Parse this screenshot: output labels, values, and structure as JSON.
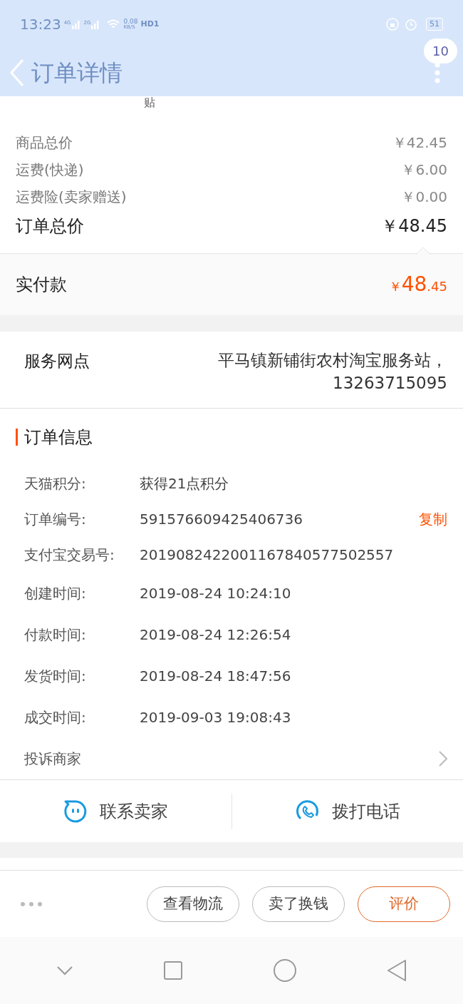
{
  "status_bar": {
    "time": "13:23",
    "signal_labels": [
      "4G",
      "2G"
    ],
    "speed": [
      "0.08",
      "KB/S"
    ],
    "hd": "HD1",
    "battery": "51"
  },
  "header": {
    "title": "订单详情",
    "badge": "10"
  },
  "cut_text": "贴",
  "prices": [
    {
      "label": "商品总价",
      "value": "￥42.45",
      "kind": "minor"
    },
    {
      "label": "运费(快递)",
      "value": "￥6.00",
      "kind": "minor"
    },
    {
      "label": "运费险(卖家赠送)",
      "value": "￥0.00",
      "kind": "minor"
    },
    {
      "label": "订单总价",
      "value": "￥48.45",
      "kind": "total"
    }
  ],
  "paid": {
    "label": "实付款",
    "currency": "￥",
    "integer": "48",
    "decimal": ".45"
  },
  "service": {
    "label": "服务网点",
    "value": "平马镇新铺街农村淘宝服务站，13263715095"
  },
  "order_info": {
    "title": "订单信息",
    "rows": [
      {
        "label": "天猫积分:",
        "value": "获得21点积分"
      },
      {
        "label": "订单编号:",
        "value": "591576609425406736",
        "action": "复制"
      },
      {
        "label": "支付宝交易号:",
        "value": "2019082422001167840577502557"
      },
      {
        "label": "创建时间:",
        "value": "2019-08-24 10:24:10"
      },
      {
        "label": "付款时间:",
        "value": "2019-08-24 12:26:54"
      },
      {
        "label": "发货时间:",
        "value": "2019-08-24 18:47:56"
      },
      {
        "label": "成交时间:",
        "value": "2019-09-03 19:08:43"
      }
    ],
    "complaint": "投诉商家"
  },
  "contact": [
    {
      "label": "联系卖家",
      "kind": "chat"
    },
    {
      "label": "拨打电话",
      "kind": "phone"
    }
  ],
  "actions": [
    {
      "label": "查看物流",
      "primary": false
    },
    {
      "label": "卖了换钱",
      "primary": false
    },
    {
      "label": "评价",
      "primary": true
    }
  ]
}
